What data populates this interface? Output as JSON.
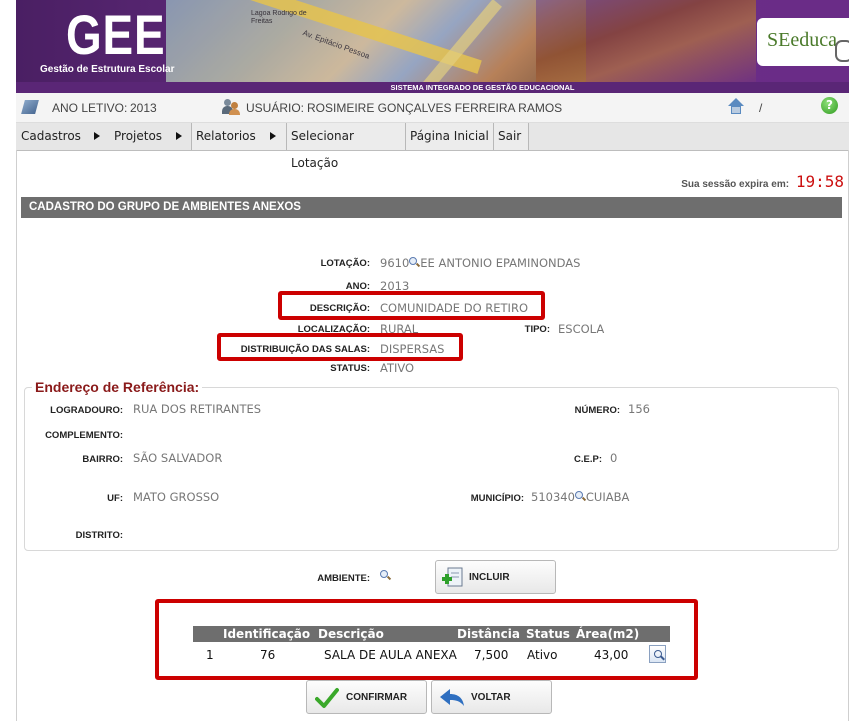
{
  "header": {
    "logo": "GEE",
    "logo_subtitle": "Gestão de Estrutura Escolar",
    "system_title": "SISTEMA INTEGRADO DE GESTÃO EDUCACIONAL",
    "seduc_logo": "SEeduca",
    "map_labels": [
      "Lagoa Rodrigo de Freitas",
      "Av. Epitácio Pessoa"
    ]
  },
  "info": {
    "ano_letivo_label": "ANO LETIVO:",
    "ano_letivo_value": "2013",
    "usuario_label": "USUÁRIO:",
    "usuario_value": "ROSIMEIRE GONÇALVES FERREIRA RAMOS",
    "slash": "/",
    "help": "?"
  },
  "menu": {
    "cadastros": "Cadastros",
    "projetos": "Projetos",
    "relatorios": "Relatorios",
    "selecionar_lotacao": "Selecionar Lotação",
    "pagina_inicial": "Página Inicial",
    "sair": "Sair"
  },
  "session": {
    "label": "Sua sessão expira em:",
    "time": "19:58"
  },
  "section_title": "CADASTRO DO GRUPO DE AMBIENTES ANEXOS",
  "form": {
    "lotacao_label": "LOTAÇÃO:",
    "lotacao_code": "9610",
    "lotacao_name": "EE ANTONIO EPAMINONDAS",
    "ano_label": "ANO:",
    "ano_value": "2013",
    "descricao_label": "DESCRIÇÃO:",
    "descricao_value": "COMUNIDADE DO RETIRO",
    "localizacao_label": "LOCALIZAÇÃO:",
    "localizacao_value": "RURAL",
    "tipo_label": "TIPO:",
    "tipo_value": "ESCOLA",
    "distribuicao_label": "DISTRIBUIÇÃO DAS SALAS:",
    "distribuicao_value": "DISPERSAS",
    "status_label": "STATUS:",
    "status_value": "ATIVO"
  },
  "address": {
    "legend": "Endereço de Referência:",
    "logradouro_label": "LOGRADOURO:",
    "logradouro_value": "RUA DOS RETIRANTES",
    "numero_label": "NÚMERO:",
    "numero_value": "156",
    "complemento_label": "COMPLEMENTO:",
    "complemento_value": "",
    "bairro_label": "BAIRRO:",
    "bairro_value": "SÃO SALVADOR",
    "cep_label": "C.E.P:",
    "cep_value": "0",
    "uf_label": "UF:",
    "uf_value": "MATO GROSSO",
    "municipio_label": "MUNICÍPIO:",
    "municipio_code": "510340",
    "municipio_name": "CUIABA",
    "distrito_label": "DISTRITO:",
    "distrito_value": ""
  },
  "ambiente": {
    "label": "AMBIENTE:",
    "incluir_button": "INCLUIR"
  },
  "table": {
    "columns": [
      "Identificação",
      "Descrição",
      "Distância",
      "Status",
      "Área(m2)"
    ],
    "rows": [
      {
        "index": "1",
        "identificacao": "76",
        "descricao": "SALA DE AULA ANEXA",
        "distancia": "7,500",
        "status": "Ativo",
        "area": "43,00"
      }
    ]
  },
  "actions": {
    "confirmar": "CONFIRMAR",
    "voltar": "VOLTAR"
  },
  "colors": {
    "banner_purple": "#6a2c87",
    "section_header": "#6e6e6e",
    "highlight_red": "#cc0000",
    "session_time_red": "#cc1010",
    "legend_red": "#8a1a1a"
  }
}
